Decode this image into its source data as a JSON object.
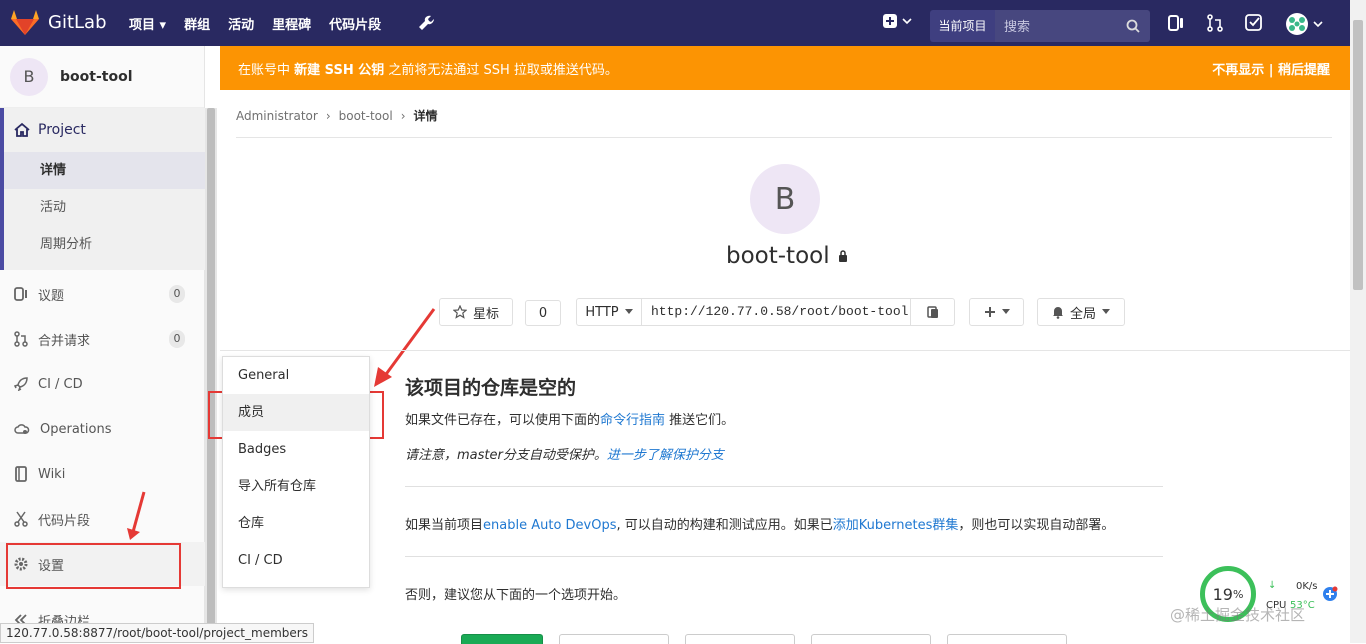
{
  "nav": {
    "brand": "GitLab",
    "links": [
      "项目 ▾",
      "群组",
      "活动",
      "里程碑",
      "代码片段"
    ],
    "search_scope": "当前项目",
    "search_placeholder": "搜索"
  },
  "sidebar": {
    "project_avatar": "B",
    "project_name": "boot-tool",
    "project_head": "Project",
    "project_subitems": [
      "详情",
      "活动",
      "周期分析"
    ],
    "issues": "议题",
    "issues_count": "0",
    "merge_requests": "合并请求",
    "mr_count": "0",
    "ci_cd": "CI / CD",
    "operations": "Operations",
    "wiki": "Wiki",
    "snippets": "代码片段",
    "settings": "设置",
    "collapse": "折叠边栏"
  },
  "banner": {
    "text_before": "在账号中",
    "text_bold": "新建 SSH 公钥",
    "text_after": "之前将无法通过 SSH 拉取或推送代码。",
    "actions": "不再显示 | 稍后提醒"
  },
  "breadcrumb": [
    "Administrator",
    "boot-tool",
    "详情"
  ],
  "project": {
    "avatar": "B",
    "title": "boot-tool",
    "star_label": "星标",
    "star_count": "0",
    "protocol": "HTTP",
    "clone_url": "http://120.77.0.58/root/boot-tool.git",
    "notification": "全局"
  },
  "settings_menu": [
    "General",
    "成员",
    "Badges",
    "导入所有仓库",
    "仓库",
    "CI / CD"
  ],
  "empty_repo": {
    "heading": "该项目的仓库是空的",
    "line1_before": "如果文件已存在，可以使用下面的",
    "line1_link": "命令行指南",
    "line1_after": "推送它们。",
    "note_before": "请注意，master分支自动受保护。",
    "note_link": "进一步了解保护分支",
    "devops_before": "如果当前项目",
    "devops_link": "enable Auto DevOps",
    "devops_middle": ", 可以自动的构建和测试应用。如果已",
    "devops_link2": "添加Kubernetes群集",
    "devops_after": "，则也可以实现自动部署。",
    "otherwise": "否则，建议您从下面的一个选项开始。"
  },
  "status_bar_url": "120.77.0.58:8877/root/boot-tool/project_members",
  "overlay": {
    "cpu_percent": "19",
    "percent_sign": "%",
    "net_speed": "0K/s",
    "cpu_label": "CPU",
    "cpu_temp": "53°C",
    "watermark": "@稀土掘金技术社区"
  },
  "colors": {
    "navbar": "#292961",
    "banner": "#fc9403",
    "link": "#1f78d1",
    "highlight_box": "#e53935"
  }
}
